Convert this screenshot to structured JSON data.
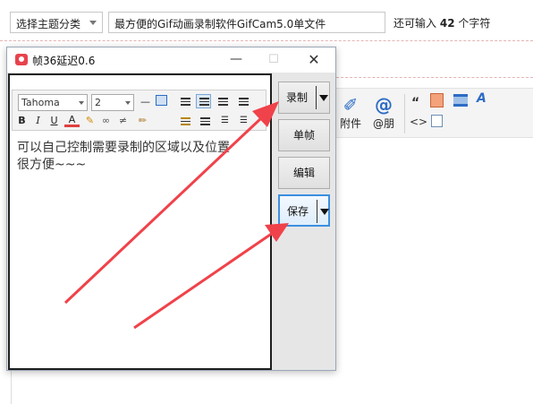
{
  "editor": {
    "category_select": "选择主题分类",
    "title_value": "最方便的Gif动画录制软件GifCam5.0单文件",
    "counter_prefix": "还可输入",
    "counter_value": "42",
    "counter_suffix": "个字符",
    "toolbar": {
      "attachment_label": "附件",
      "mention_label": "@朋",
      "quote_glyph": "“",
      "code_glyph": "<>"
    }
  },
  "gifcam": {
    "title": "帧36延迟0.6",
    "minimize": "—",
    "maximize": "☐",
    "close": "✕",
    "buttons": {
      "record": "录制",
      "frame": "单帧",
      "edit": "编辑",
      "save": "保存"
    }
  },
  "captured_editor": {
    "font": "Tahoma",
    "size": "2",
    "bold": "B",
    "italic": "I",
    "underline": "U",
    "font_color": "A",
    "text_line1": "可以自己控制需要录制的区域以及位置",
    "text_line2": "很方便~~~"
  },
  "colors": {
    "arrow": "#f0424a",
    "focus_border": "#3c8fe0",
    "app_icon": "#e8424e"
  }
}
